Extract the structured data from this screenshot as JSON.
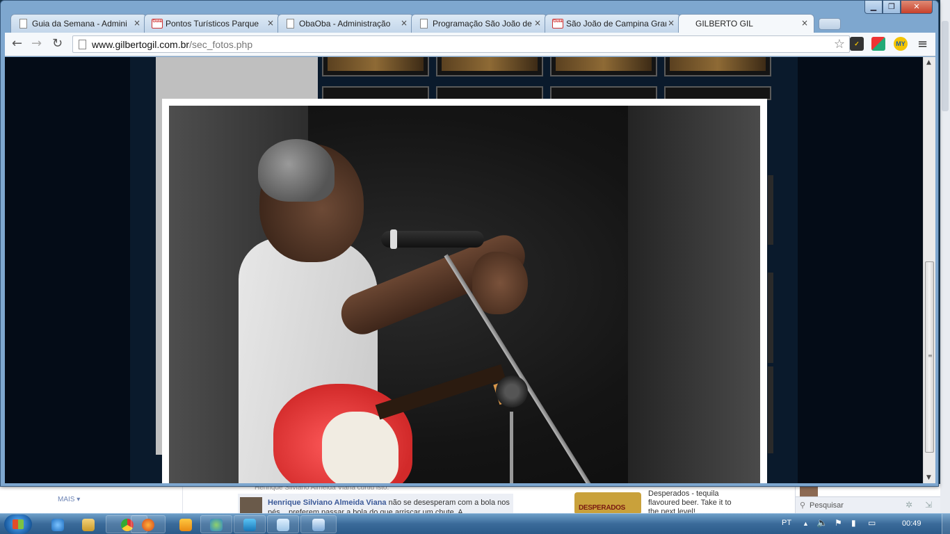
{
  "browser": {
    "window_controls": {
      "minimize": "▁",
      "maximize": "❐",
      "close": "✕"
    },
    "tabs": [
      {
        "label": "Guia da Semana - Admini",
        "favicon": "page-icon"
      },
      {
        "label": "Pontos Turísticos Parque",
        "favicon": "guia-icon"
      },
      {
        "label": "ObaOba - Administração",
        "favicon": "page-icon"
      },
      {
        "label": "Programação São João de",
        "favicon": "page-icon"
      },
      {
        "label": "São João de Campina Grar",
        "favicon": "guia-icon"
      },
      {
        "label": "GILBERTO GIL",
        "favicon": "none",
        "active": true
      }
    ],
    "tab_close": "×",
    "url_domain": "www.gilbertogil.com.br",
    "url_path": "/sec_fotos.php",
    "extensions": {
      "e1": "✓",
      "e3": "MY"
    }
  },
  "background_page": {
    "more_label": "MAIS ▾",
    "feed_top_text": "Henrique Silviano Almeida Viana curtiu isto.",
    "feed_author": "Henrique Silviano Almeida Viana",
    "feed_text": " não se desesperam com a bola nos pés... preferem passar a bola do que arriscar um chute. A",
    "ad_brand": "DESPERADOS",
    "ad_text": "Desperados - tequila flavoured beer. Take it to the next level!",
    "chat_search_placeholder": "Pesquisar"
  },
  "taskbar": {
    "language": "PT",
    "clock": "00:49"
  },
  "colors": {
    "window_frame": "#7ea7cf",
    "page_background": "#040c17",
    "lightbox_frame": "#ffffff",
    "guitar": "#e23a3a"
  }
}
